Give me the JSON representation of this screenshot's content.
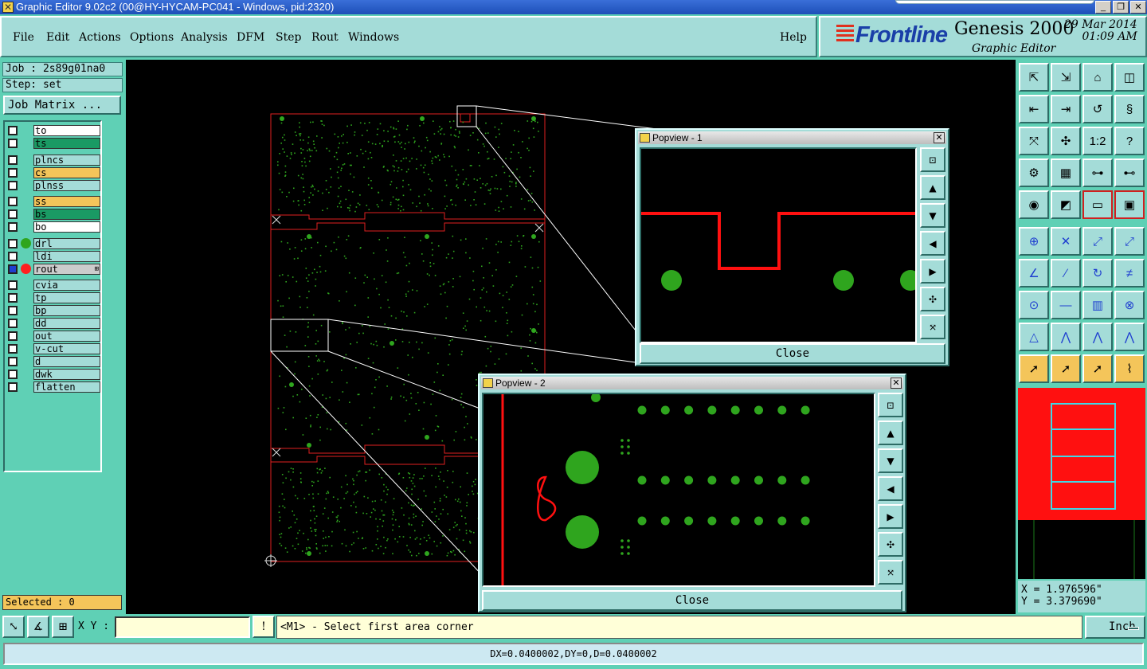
{
  "window": {
    "title": "Graphic Editor 9.02c2 (00@HY-HYCAM-PC041 - Windows, pid:2320)",
    "controls": [
      "_",
      "❐",
      "✕"
    ]
  },
  "menu": {
    "items": [
      "File",
      "Edit",
      "Actions",
      "Options",
      "Analysis",
      "DFM",
      "Step",
      "Rout",
      "Windows"
    ],
    "help": "Help"
  },
  "brand": {
    "logo": "Frontline",
    "product": "Genesis 2000",
    "subtitle": "Graphic Editor",
    "date": "29 Mar 2014",
    "time": "01:09 AM"
  },
  "job": {
    "job_label": "Job : 2s89g01na0",
    "step_label": "Step: set",
    "matrix_button": "Job Matrix ..."
  },
  "layers": [
    {
      "name": "to",
      "color": "#ffffff",
      "dot": ""
    },
    {
      "name": "ts",
      "color": "#1a9a64",
      "dot": ""
    },
    {
      "name": "plncs",
      "color": "#a4dcd8",
      "dot": ""
    },
    {
      "name": "cs",
      "color": "#f4c55a",
      "dot": ""
    },
    {
      "name": "plnss",
      "color": "#a4dcd8",
      "dot": ""
    },
    {
      "name": "ss",
      "color": "#f4c55a",
      "dot": ""
    },
    {
      "name": "bs",
      "color": "#1a9a64",
      "dot": ""
    },
    {
      "name": "bo",
      "color": "#ffffff",
      "dot": ""
    },
    {
      "name": "drl",
      "color": "#a4dcd8",
      "dot": "#2fa51e"
    },
    {
      "name": "ldi",
      "color": "#a4dcd8",
      "dot": ""
    },
    {
      "name": "rout",
      "color": "#cccccc",
      "dot": "#ff2020",
      "more": "⊞",
      "active": true
    },
    {
      "name": "cvia",
      "color": "#a4dcd8",
      "dot": ""
    },
    {
      "name": "tp",
      "color": "#a4dcd8",
      "dot": ""
    },
    {
      "name": "bp",
      "color": "#a4dcd8",
      "dot": ""
    },
    {
      "name": "dd",
      "color": "#a4dcd8",
      "dot": ""
    },
    {
      "name": "out",
      "color": "#a4dcd8",
      "dot": ""
    },
    {
      "name": "v-cut",
      "color": "#a4dcd8",
      "dot": ""
    },
    {
      "name": "d",
      "color": "#a4dcd8",
      "dot": ""
    },
    {
      "name": "dwk",
      "color": "#a4dcd8",
      "dot": ""
    },
    {
      "name": "flatten",
      "color": "#a4dcd8",
      "dot": ""
    }
  ],
  "selected": "Selected : 0",
  "popview1": {
    "title": "Popview - 1",
    "close": "Close"
  },
  "popview2": {
    "title": "Popview - 2",
    "close": "Close"
  },
  "toolbar": {
    "icons": [
      "⇱",
      "⇲",
      "⌂",
      "◫",
      "⇤",
      "⇥",
      "↺",
      "§",
      "⤧",
      "✣",
      "1:2",
      "?",
      "⚙",
      "▦",
      "⊶",
      "⊷",
      "◉",
      "◩",
      "▭",
      "▣",
      "⊕",
      "✕",
      "⤢",
      "⤢",
      "∠",
      "∕",
      "↻",
      "≠",
      "⊙",
      "—",
      "▥",
      "⊗",
      "△",
      "⋀",
      "⋀",
      "⋀",
      "➚",
      "➚",
      "➚",
      "⌇"
    ]
  },
  "coords": {
    "x": "X = 1.976596\"",
    "y": "Y = 3.379690\""
  },
  "bottom": {
    "xy_label": "X Y :",
    "prompt": "<M1> - Select first area corner",
    "units": "Inch",
    "alert_icon": "!"
  },
  "status": "DX=0.0400002,DY=0,D=0.0400002",
  "colors": {
    "accent": "#5fd0b5",
    "panel": "#a4dcd8",
    "rout": "#ff2020",
    "drill": "#2fa51e",
    "highlight": "#f4c55a"
  }
}
